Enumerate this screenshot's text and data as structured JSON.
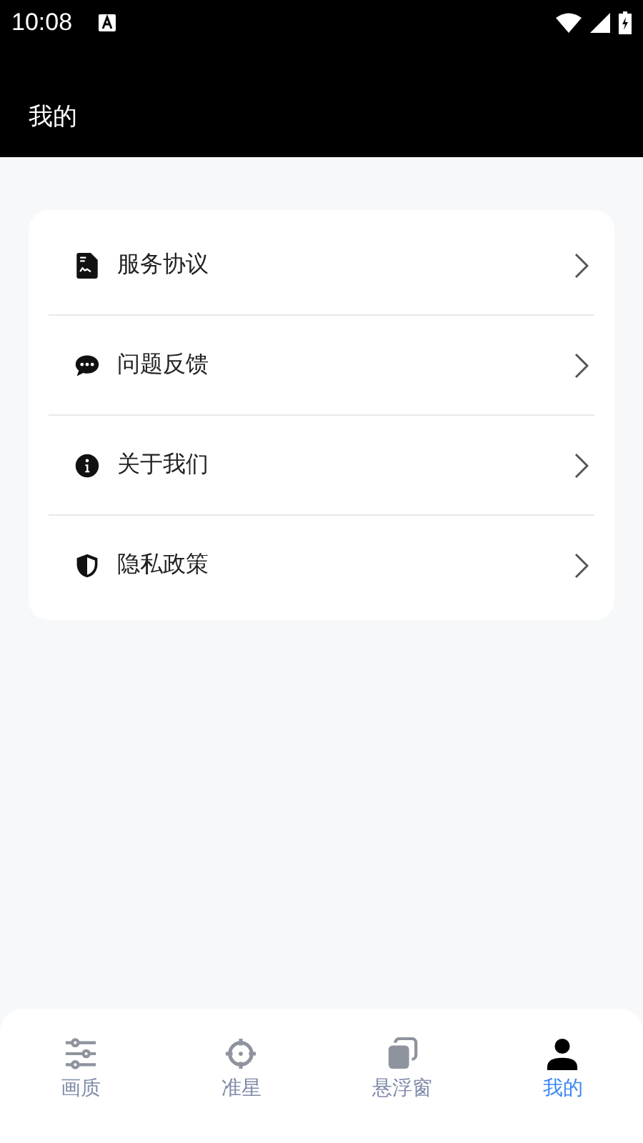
{
  "status_bar": {
    "time": "10:08"
  },
  "header": {
    "title": "我的"
  },
  "menu": [
    {
      "kind": "document",
      "label": "服务协议"
    },
    {
      "kind": "chat",
      "label": "问题反馈"
    },
    {
      "kind": "info",
      "label": "关于我们"
    },
    {
      "kind": "shield",
      "label": "隐私政策"
    }
  ],
  "tabs": [
    {
      "kind": "sliders",
      "label": "画质",
      "selected": false
    },
    {
      "kind": "crosshair",
      "label": "准星",
      "selected": false
    },
    {
      "kind": "windows",
      "label": "悬浮窗",
      "selected": false
    },
    {
      "kind": "person",
      "label": "我的",
      "selected": true
    }
  ]
}
